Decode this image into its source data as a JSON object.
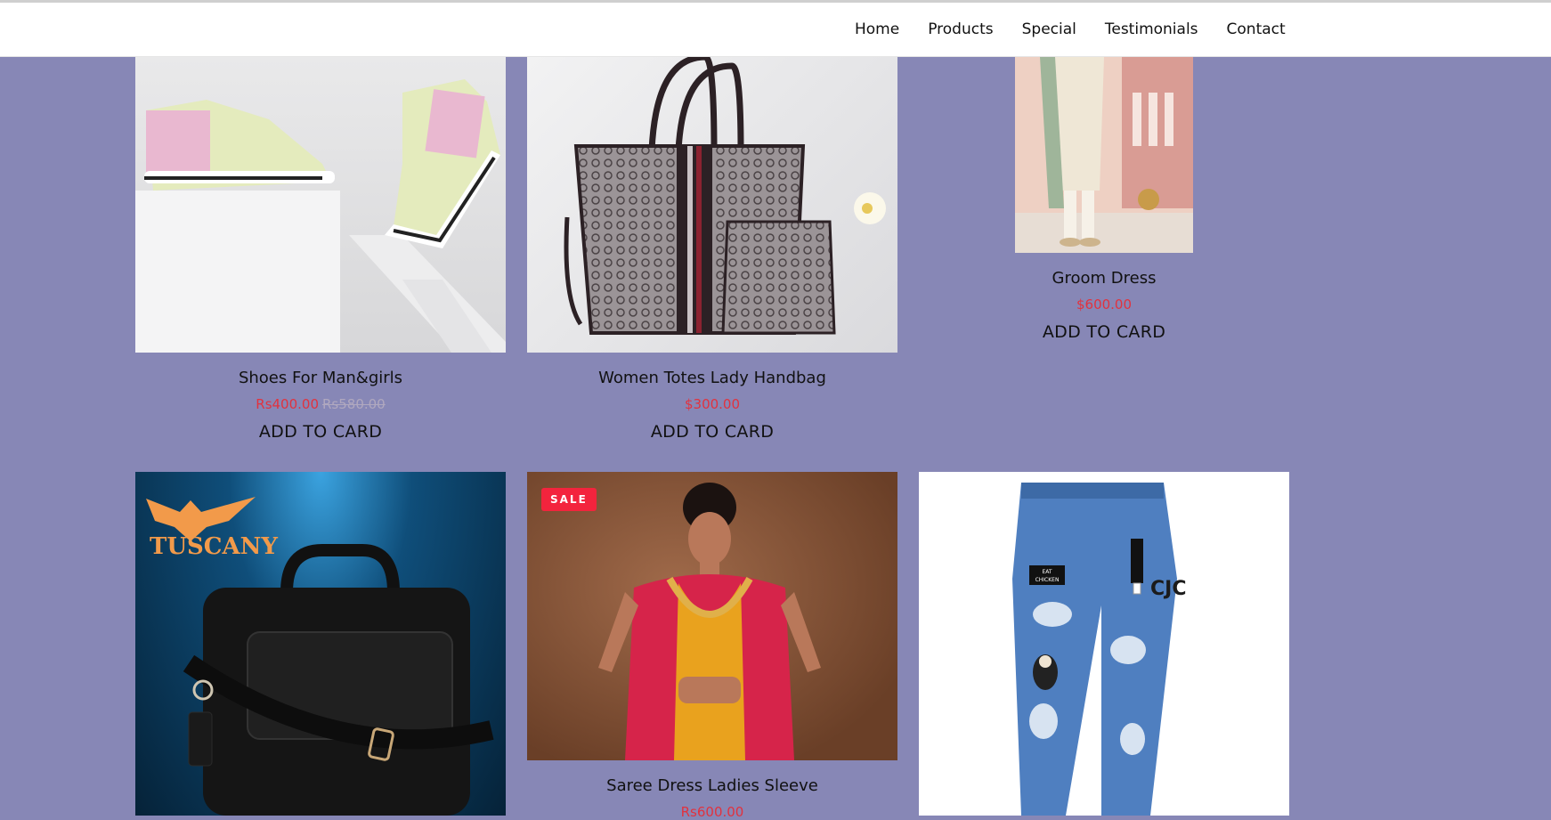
{
  "nav": {
    "items": [
      "Home",
      "Products",
      "Special",
      "Testimonials",
      "Contact"
    ]
  },
  "products": [
    {
      "title": "Shoes For Man&girls",
      "price": "Rs400.00",
      "old_price": "Rs580.00",
      "cta": "ADD TO CARD"
    },
    {
      "title": "Women Totes Lady Handbag",
      "price": "$300.00",
      "cta": "ADD TO CARD"
    },
    {
      "title": "Groom Dress",
      "price": "$600.00",
      "cta": "ADD TO CARD"
    },
    {
      "brand": "TUSCANY"
    },
    {
      "badge": "SALE",
      "title": "Saree Dress Ladies Sleeve",
      "price": "Rs600.00"
    },
    {
      "patch": "EAT CHICKEN"
    }
  ],
  "colors": {
    "page_bg": "#8787b6",
    "header_bg": "#ffffff",
    "price": "#e2323e",
    "old_price": "#b0a8bf",
    "sale_badge": "#f3243d"
  }
}
